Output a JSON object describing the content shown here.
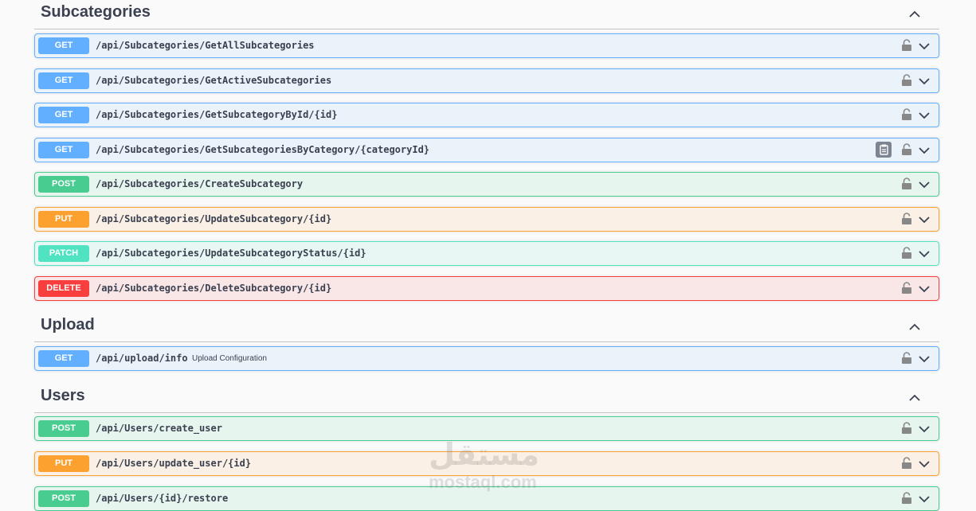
{
  "sections": [
    {
      "title": "Subcategories",
      "operations": [
        {
          "method": "GET",
          "path": "/api/Subcategories/GetAllSubcategories",
          "summary": ""
        },
        {
          "method": "GET",
          "path": "/api/Subcategories/GetActiveSubcategories",
          "summary": ""
        },
        {
          "method": "GET",
          "path": "/api/Subcategories/GetSubcategoryById/{id}",
          "summary": ""
        },
        {
          "method": "GET",
          "path": "/api/Subcategories/GetSubcategoriesByCategory/{categoryId}",
          "summary": ""
        },
        {
          "method": "POST",
          "path": "/api/Subcategories/CreateSubcategory",
          "summary": ""
        },
        {
          "method": "PUT",
          "path": "/api/Subcategories/UpdateSubcategory/{id}",
          "summary": ""
        },
        {
          "method": "PATCH",
          "path": "/api/Subcategories/UpdateSubcategoryStatus/{id}",
          "summary": ""
        },
        {
          "method": "DELETE",
          "path": "/api/Subcategories/DeleteSubcategory/{id}",
          "summary": ""
        }
      ]
    },
    {
      "title": "Upload",
      "operations": [
        {
          "method": "GET",
          "path": "/api/upload/info",
          "summary": "Upload Configuration"
        }
      ]
    },
    {
      "title": "Users",
      "operations": [
        {
          "method": "POST",
          "path": "/api/Users/create_user",
          "summary": ""
        },
        {
          "method": "PUT",
          "path": "/api/Users/update_user/{id}",
          "summary": ""
        },
        {
          "method": "POST",
          "path": "/api/Users/{id}/restore",
          "summary": ""
        }
      ]
    }
  ],
  "icons": {
    "section_toggle": "chevron-up-icon",
    "operation_auth": "lock-icon",
    "operation_expand": "chevron-down-icon",
    "copy": "clipboard-copy-icon"
  },
  "colors": {
    "get": "#61affe",
    "post": "#49cc90",
    "put": "#fca130",
    "patch": "#50e3c2",
    "delete": "#f93e3e",
    "text": "#3b4151"
  },
  "watermark": {
    "logo_text": "مستقل",
    "text": "mostaql.com"
  }
}
